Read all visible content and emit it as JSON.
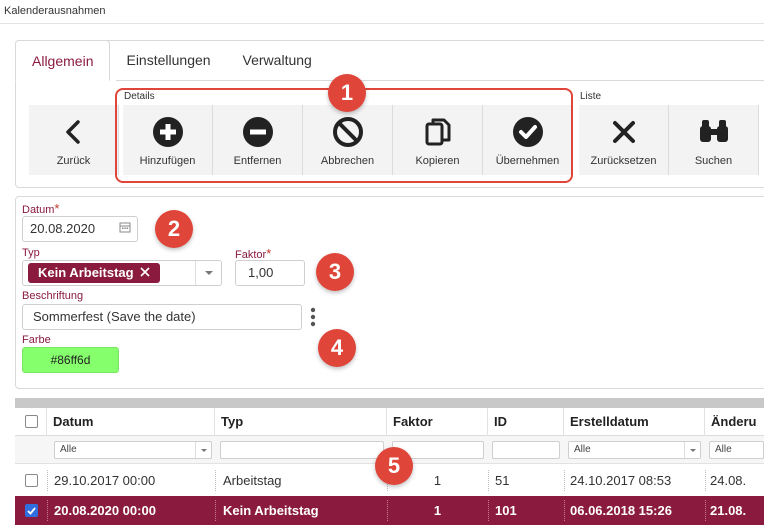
{
  "window": {
    "title": "Kalenderausnahmen"
  },
  "tabs": [
    {
      "label": "Allgemein",
      "active": true
    },
    {
      "label": "Einstellungen",
      "active": false
    },
    {
      "label": "Verwaltung",
      "active": false
    }
  ],
  "toolbar": {
    "group_details": "Details",
    "group_liste": "Liste",
    "back": {
      "label": "Zurück",
      "icon": "chevron-left-icon"
    },
    "add": {
      "label": "Hinzufügen",
      "icon": "plus-circle-icon"
    },
    "remove": {
      "label": "Entfernen",
      "icon": "minus-circle-icon"
    },
    "cancel": {
      "label": "Abbrechen",
      "icon": "ban-icon"
    },
    "copy": {
      "label": "Kopieren",
      "icon": "copy-icon"
    },
    "apply": {
      "label": "Übernehmen",
      "icon": "check-circle-icon"
    },
    "reset": {
      "label": "Zurücksetzen",
      "icon": "x-icon"
    },
    "search": {
      "label": "Suchen",
      "icon": "binoculars-icon"
    }
  },
  "annotations": [
    "1",
    "2",
    "3",
    "4",
    "5"
  ],
  "form": {
    "datum_label": "Datum",
    "datum_value": "20.08.2020",
    "typ_label": "Typ",
    "typ_value": "Kein Arbeitstag",
    "faktor_label": "Faktor",
    "faktor_value": "1,00",
    "beschriftung_label": "Beschriftung",
    "beschriftung_value": "Sommerfest (Save the date)",
    "farbe_label": "Farbe",
    "farbe_value": "#86ff6d",
    "required_mark": "*"
  },
  "grid": {
    "columns": [
      "Datum",
      "Typ",
      "Faktor",
      "ID",
      "Erstelldatum",
      "Änderu"
    ],
    "filters": [
      "Alle",
      "Alle",
      "Alle"
    ],
    "rows": [
      {
        "checked": false,
        "datum": "29.10.2017 00:00",
        "typ": "Arbeitstag",
        "faktor": "1",
        "id": "51",
        "erstelldatum": "24.10.2017 08:53",
        "aenderung": "24.08."
      },
      {
        "checked": true,
        "datum": "20.08.2020 00:00",
        "typ": "Kein Arbeitstag",
        "faktor": "1",
        "id": "101",
        "erstelldatum": "06.06.2018 15:26",
        "aenderung": "21.08."
      }
    ]
  },
  "colors": {
    "accent": "#8a1b3f",
    "annotation": "#e0453a",
    "swatch": "#86ff6d"
  }
}
